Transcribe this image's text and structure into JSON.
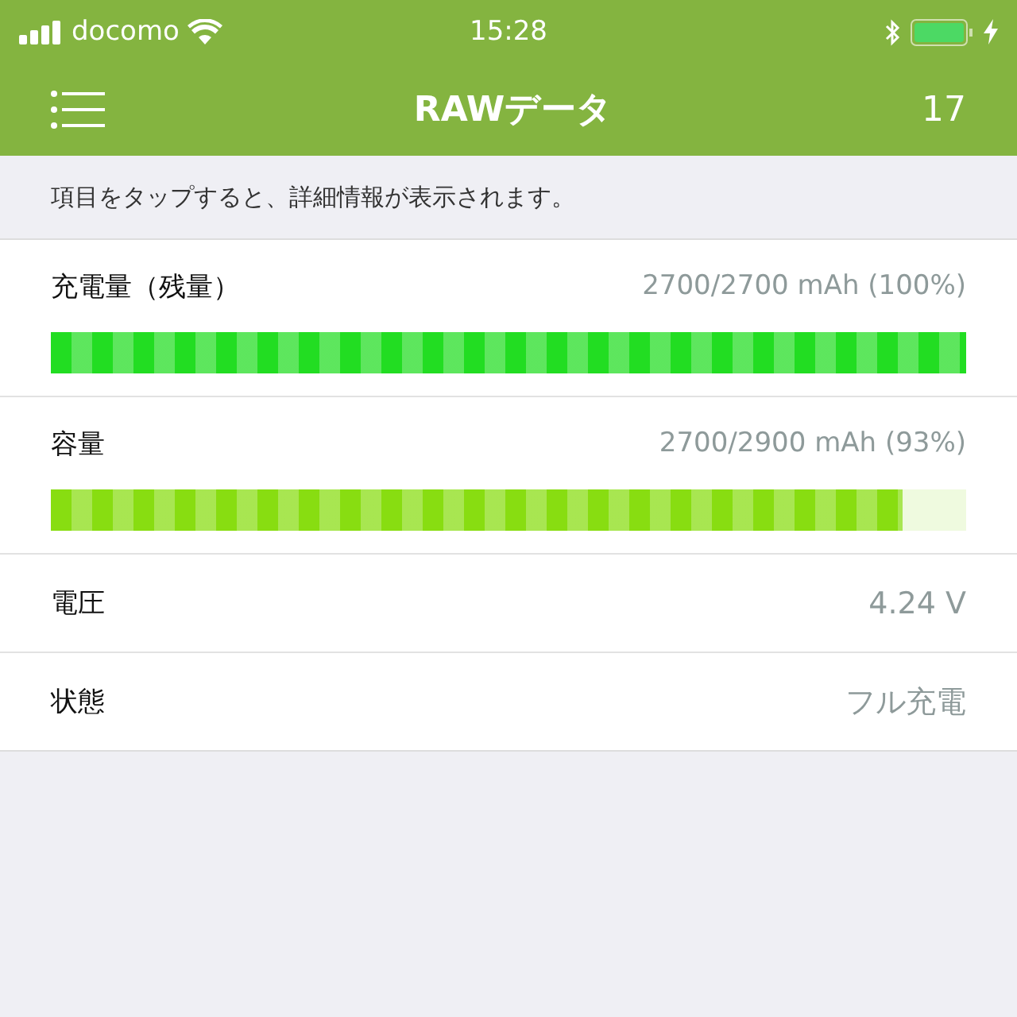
{
  "status_bar": {
    "carrier": "docomo",
    "time": "15:28"
  },
  "nav": {
    "title": "RAWデータ",
    "count": "17"
  },
  "hint": "項目をタップすると、詳細情報が表示されます。",
  "rows": [
    {
      "kind": "bar",
      "label": "充電量（残量）",
      "value": "2700/2700 mAh (100%)",
      "level": 1.0,
      "color": "#22dd22"
    },
    {
      "kind": "bar",
      "label": "容量",
      "value": "2700/2900 mAh (93%)",
      "level": 0.93,
      "color": "#88dd11"
    },
    {
      "kind": "value",
      "label": "電圧",
      "value": "4.24 V"
    },
    {
      "kind": "value",
      "label": "状態",
      "value": "フル充電"
    }
  ]
}
